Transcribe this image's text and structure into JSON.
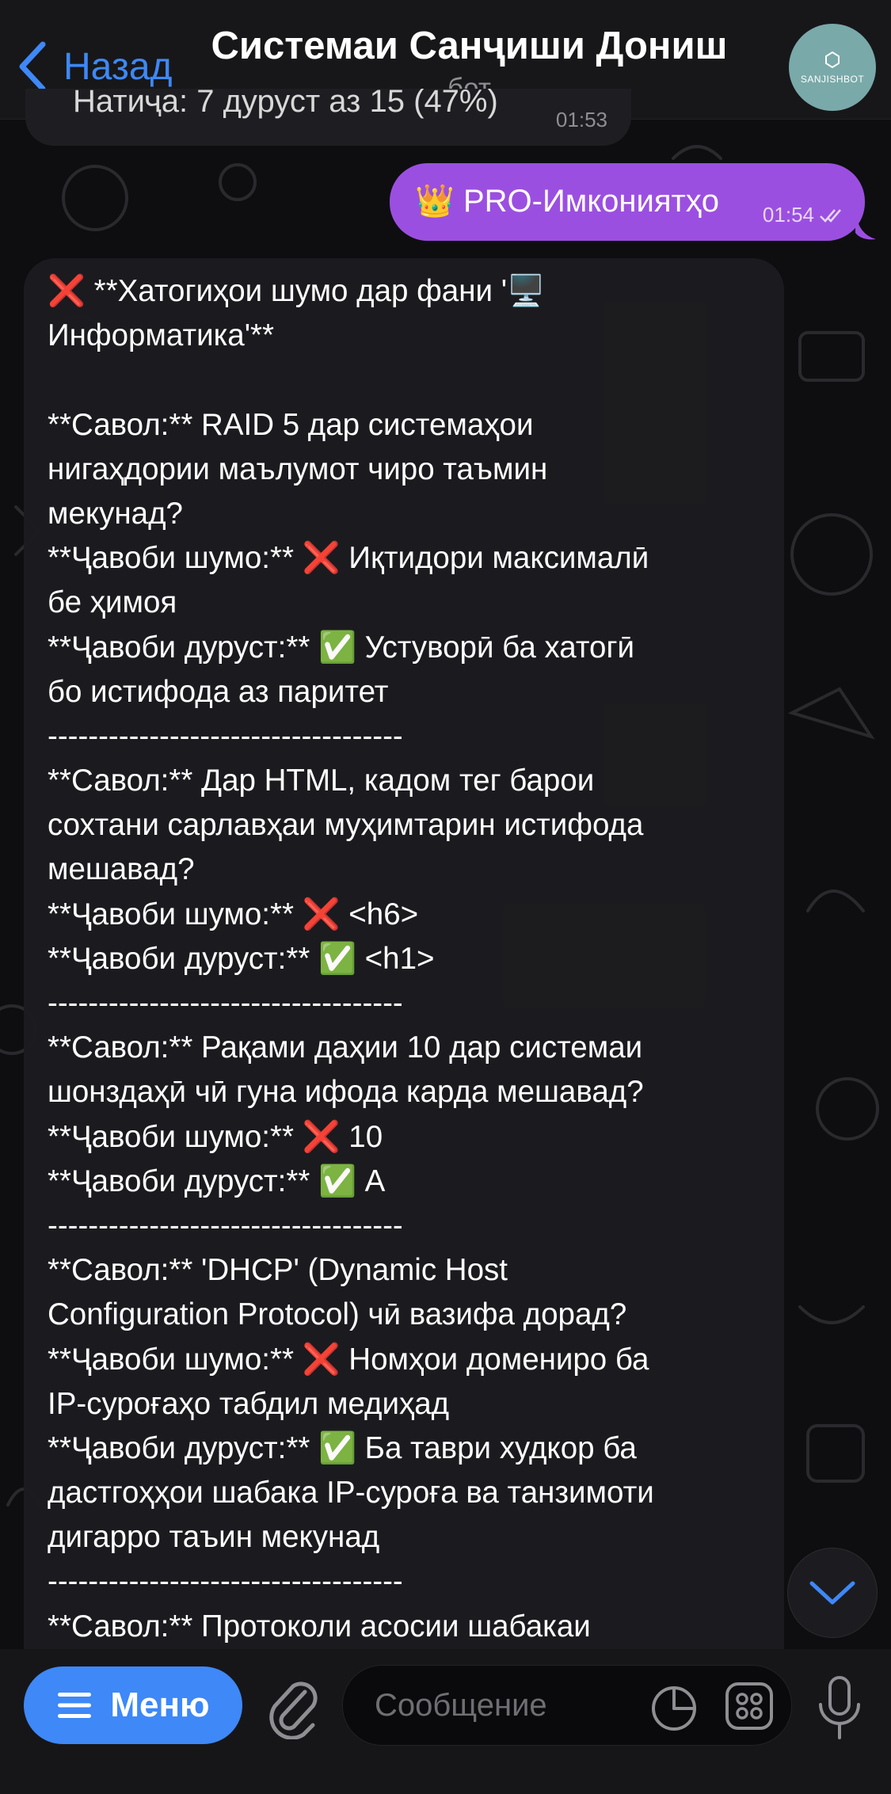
{
  "header": {
    "back_label": "Назад",
    "title": "Системаи Санҷиши Дониш",
    "subtitle": "бот",
    "avatar_text": "SANJISHBOT"
  },
  "previous_message": {
    "text": "Натиҷа: 7 дуруст аз 15 (47%)",
    "time": "01:53"
  },
  "outgoing_message": {
    "emoji": "👑",
    "text": "PRO-Имкониятҳо",
    "time": "01:54"
  },
  "incoming_message": {
    "lines": [
      "❌ **Хатогиҳои шумо дар фани '🖥️",
      "Информатика'**",
      "",
      "**Савол:** RAID 5 дар системаҳои",
      "нигаҳдории маълумот чиро таъмин",
      "мекунад?",
      "**Ҷавоби шумо:** ❌ Иқтидори максималӣ",
      "бе ҳимоя",
      "**Ҷавоби дуруст:** ✅ Устуворӣ ба хатогӣ",
      "бо истифода аз паритет",
      "-----------------------------------",
      "**Савол:** Дар HTML, кадом тег барои",
      "сохтани сарлавҳаи муҳимтарин истифода",
      "мешавад?",
      "**Ҷавоби шумо:** ❌ <h6>",
      "**Ҷавоби дуруст:** ✅ <h1>",
      "-----------------------------------",
      "**Савол:** Рақами даҳии 10 дар системаи",
      "шонздаҳӣ чӣ гуна ифода карда мешавад?",
      "**Ҷавоби шумо:** ❌ 10",
      "**Ҷавоби дуруст:** ✅ A",
      "-----------------------------------",
      "**Савол:** 'DHCP' (Dynamic Host",
      "Configuration Protocol) чӣ вазифа дорад?",
      "**Ҷавоби шумо:** ❌ Номҳои домениро ба",
      "IP-суроғаҳо табдил медиҳад",
      "**Ҷавоби дуруст:** ✅ Ба таври худкор ба",
      "дастгоҳҳои шабака IP-суроға ва танзимоти",
      "дигарро таъин мекунад",
      "-----------------------------------",
      "**Савол:** Протоколи асосии шабакаи"
    ]
  },
  "bottom_bar": {
    "menu_label": "Меню",
    "input_placeholder": "Сообщение"
  },
  "colors": {
    "accent": "#3e88f7",
    "outgoing_bubble": "#9b4fe0",
    "incoming_bubble": "#1c1c20",
    "background": "#0e0e10"
  },
  "icons": {
    "back": "chevron-left-icon",
    "menu": "hamburger-icon",
    "attach": "paperclip-icon",
    "sticker": "sticker-icon",
    "commands": "bot-commands-icon",
    "mic": "microphone-icon",
    "scroll": "chevron-down-icon",
    "read_status": "double-check-icon"
  }
}
